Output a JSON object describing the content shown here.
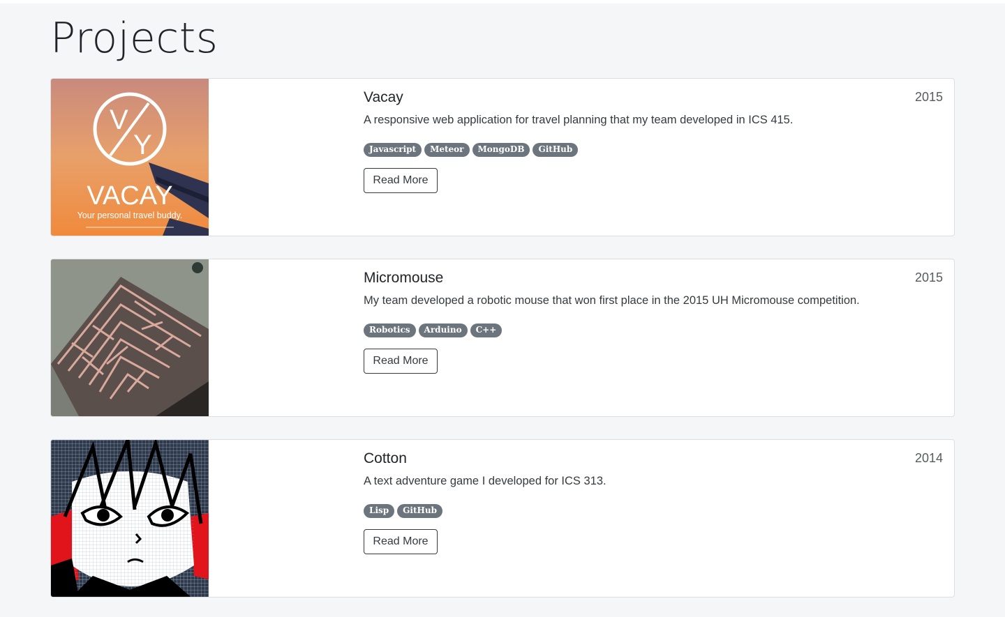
{
  "page": {
    "title": "Projects"
  },
  "projects": [
    {
      "title": "Vacay",
      "year": "2015",
      "description": "A responsive web application for travel planning that my team developed in ICS 415.",
      "tags": [
        "Javascript",
        "Meteor",
        "MongoDB",
        "GitHub"
      ],
      "button": "Read More",
      "image": {
        "logo_text": "VACAY",
        "tagline": "Your personal travel buddy.",
        "monogram_top": "V",
        "monogram_bottom": "Y"
      }
    },
    {
      "title": "Micromouse",
      "year": "2015",
      "description": "My team developed a robotic mouse that won first place in the 2015 UH Micromouse competition.",
      "tags": [
        "Robotics",
        "Arduino",
        "C++"
      ],
      "button": "Read More",
      "image": {
        "subject": "maze-photo"
      }
    },
    {
      "title": "Cotton",
      "year": "2014",
      "description": "A text adventure game I developed for ICS 313.",
      "tags": [
        "Lisp",
        "GitHub"
      ],
      "button": "Read More",
      "image": {
        "subject": "pixel-art-character"
      }
    }
  ]
}
